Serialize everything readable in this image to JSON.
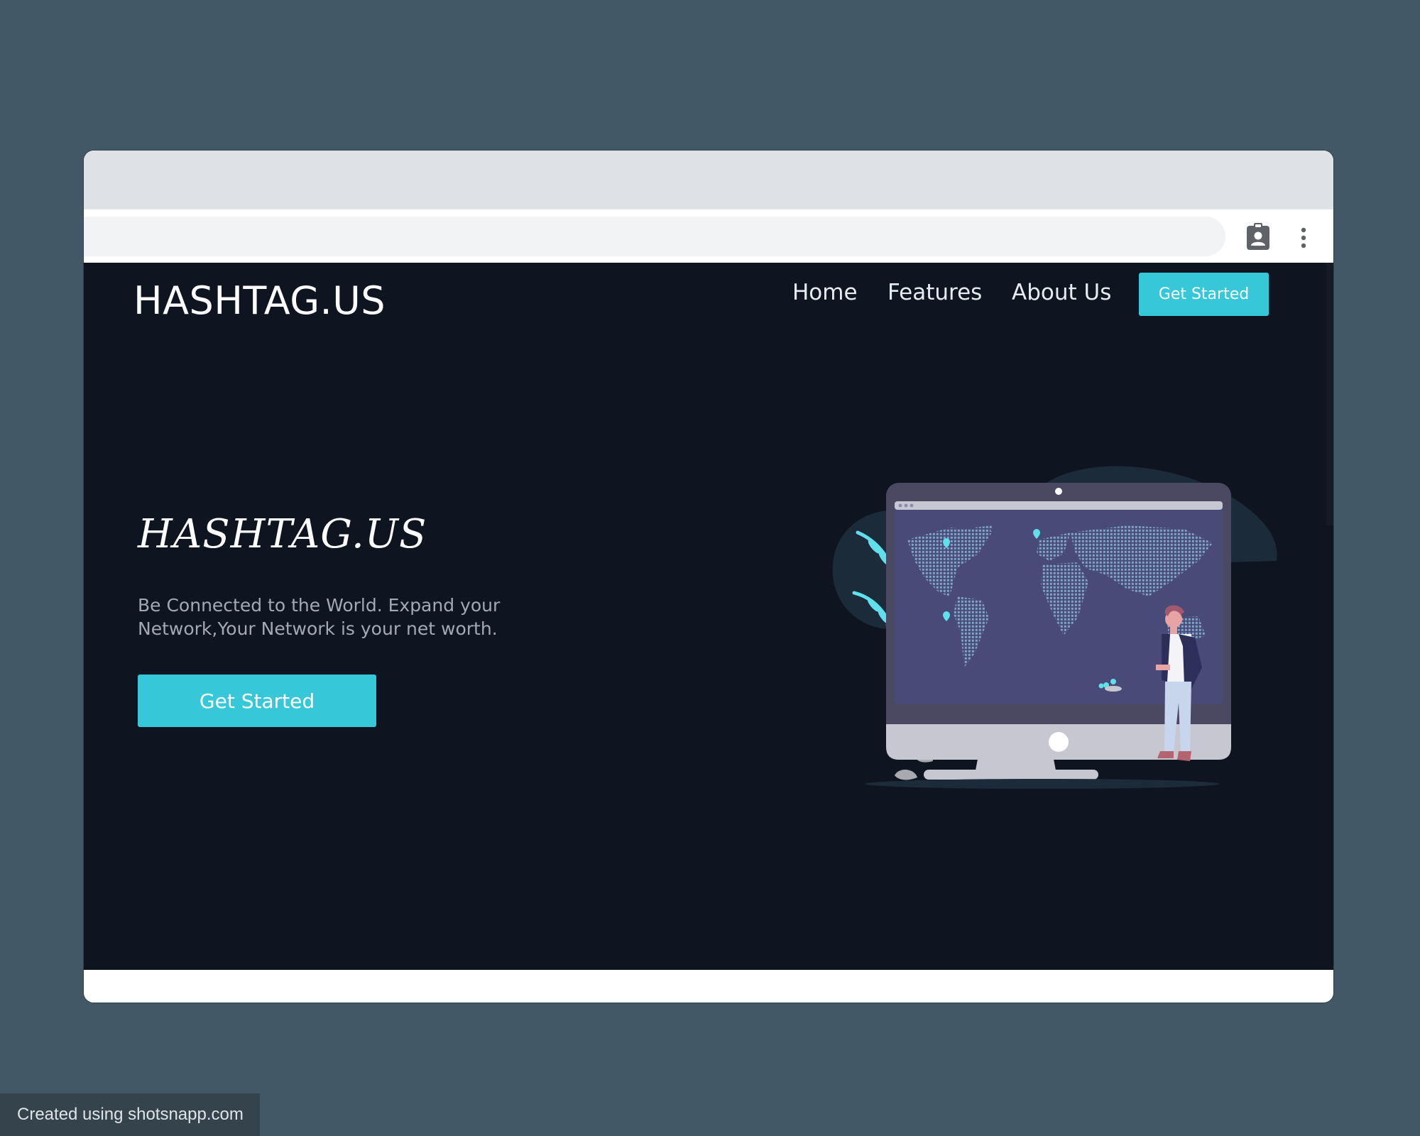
{
  "browser": {
    "profile_icon": "profile-badge-icon",
    "menu_icon": "more-vertical-icon"
  },
  "navbar": {
    "logo": "HASHTAG.US",
    "links": [
      "Home",
      "Features",
      "About Us"
    ],
    "cta_label": "Get Started"
  },
  "hero": {
    "title": "HASHTAG.US",
    "description": "Be Connected to the World. Expand your Network,Your Network is your net worth.",
    "cta_label": "Get Started",
    "illustration": "world-map-monitor-illustration"
  },
  "watermark": "Created using shotsnapp.com",
  "colors": {
    "page_background": "#0e1420",
    "accent": "#36c8d8",
    "desktop_background": "#425866"
  }
}
